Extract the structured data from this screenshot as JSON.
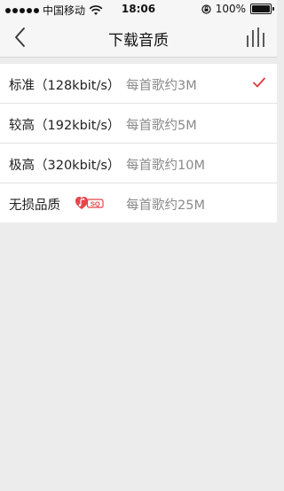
{
  "status": {
    "carrier": "中国移动",
    "time": "18:06",
    "battery": "100%",
    "battery_level": 1.0
  },
  "nav": {
    "title": "下载音质",
    "back_icon": "chevron-left-icon",
    "right_icon": "equalizer-icon"
  },
  "options": [
    {
      "name": "标准（128kbit/s）",
      "size": "每首歌约3M",
      "selected": true
    },
    {
      "name": "较高（192kbit/s）",
      "size": "每首歌约5M",
      "selected": false
    },
    {
      "name": "极高（320kbit/s）",
      "size": "每首歌约10M",
      "selected": false
    },
    {
      "name": "无损品质",
      "size": "每首歌约25M",
      "selected": false,
      "badge": "SQ"
    }
  ],
  "colors": {
    "accent": "#e0393e",
    "badge": "#e8454b"
  }
}
